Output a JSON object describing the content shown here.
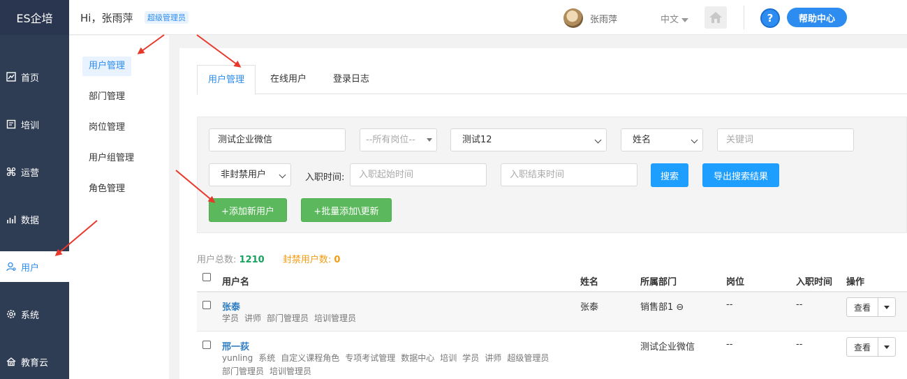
{
  "brand": "ES企培",
  "header": {
    "greeting": "Hi，张雨萍",
    "role_badge": "超级管理员",
    "user_name": "张雨萍",
    "language": "中文",
    "help_label": "帮助中心"
  },
  "leftnav": {
    "items": [
      {
        "label": "首页",
        "icon": "chart-line-icon"
      },
      {
        "label": "培训",
        "icon": "book-icon"
      },
      {
        "label": "运营",
        "icon": "command-icon"
      },
      {
        "label": "数据",
        "icon": "bar-chart-icon"
      },
      {
        "label": "用户",
        "icon": "user-icon",
        "active": true
      },
      {
        "label": "系统",
        "icon": "gear-icon"
      },
      {
        "label": "教育云",
        "icon": "cloud-icon"
      }
    ]
  },
  "subnav": {
    "items": [
      "用户管理",
      "部门管理",
      "岗位管理",
      "用户组管理",
      "角色管理"
    ],
    "active": "用户管理"
  },
  "tabs": [
    "用户管理",
    "在线用户",
    "登录日志"
  ],
  "filters": {
    "company": "测试企业微信",
    "position": "--所有岗位--",
    "test_select": "测试12",
    "field_select": "姓名",
    "keyword_placeholder": "关键词",
    "ban_select": "非封禁用户",
    "entry_time_label": "入职时间:",
    "start_placeholder": "入职起始时间",
    "end_placeholder": "入职结束时间",
    "search_label": "搜索",
    "export_label": "导出搜索结果",
    "add_user_label": "+添加新用户",
    "batch_label": "+批量添加\\更新"
  },
  "stats": {
    "total_label": "用户总数:",
    "total_value": "1210",
    "banned_label": "封禁用户数:",
    "banned_value": "0"
  },
  "table": {
    "headers": [
      "用户名",
      "姓名",
      "所属部门",
      "岗位",
      "入职时间",
      "操作"
    ],
    "rows": [
      {
        "username": "张泰",
        "tags_line1": [
          "学员",
          "讲师",
          "部门管理员",
          "培训管理员"
        ],
        "tags_line2": [],
        "name": "张泰",
        "dept": "销售部1 ⊖",
        "position": "--",
        "entry": "--",
        "action": "查看"
      },
      {
        "username": "邢一荻",
        "tags_line1": [
          "yunling",
          "系统",
          "自定义课程角色",
          "专项考试管理",
          "数据中心",
          "培训",
          "学员",
          "讲师",
          "超级管理员"
        ],
        "tags_line2": [
          "部门管理员",
          "培训管理员"
        ],
        "name": "",
        "dept": "测试企业微信",
        "position": "--",
        "entry": "--",
        "action": "查看"
      }
    ]
  },
  "colors": {
    "sidebar": "#2f3d54",
    "accent": "#2d8cf0",
    "green": "#5cb85c",
    "annotation": "#e8382a"
  }
}
